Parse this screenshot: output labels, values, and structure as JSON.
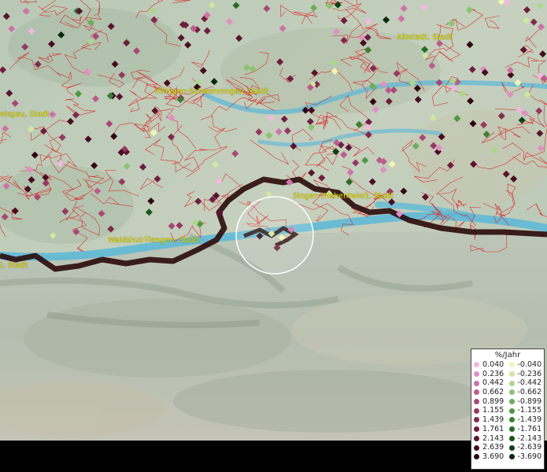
{
  "map": {
    "labels": [
      {
        "id": "albstadt",
        "text": "Albstadt, Stadt"
      },
      {
        "id": "villingen",
        "text": "Villingen-Schwenningen, Stadt"
      },
      {
        "id": "breisgau",
        "text": "eisgau, Stadt"
      },
      {
        "id": "singen",
        "text": "Singen (Hohentwiel), Stadt"
      },
      {
        "id": "waldshut",
        "text": "Waldshut-Tiengen, Stadt"
      },
      {
        "id": "west",
        "text": "), Stadt"
      }
    ]
  },
  "legend": {
    "title": "%/Jahr",
    "positive": [
      {
        "label": "0.040",
        "color": "#f2b8e0"
      },
      {
        "label": "0.236",
        "color": "#e090c4"
      },
      {
        "label": "0.442",
        "color": "#cf72a8"
      },
      {
        "label": "0.662",
        "color": "#bc5c8e"
      },
      {
        "label": "0.899",
        "color": "#a84876"
      },
      {
        "label": "1.155",
        "color": "#963862"
      },
      {
        "label": "1.439",
        "color": "#822a50"
      },
      {
        "label": "1.761",
        "color": "#6e1e40"
      },
      {
        "label": "2.143",
        "color": "#5a1430"
      },
      {
        "label": "2.639",
        "color": "#460c22"
      },
      {
        "label": "3.690",
        "color": "#300614"
      }
    ],
    "negative": [
      {
        "label": "-0.040",
        "color": "#f0f8b0"
      },
      {
        "label": "-0.236",
        "color": "#cfe8a0"
      },
      {
        "label": "-0.442",
        "color": "#acd88a"
      },
      {
        "label": "-0.662",
        "color": "#8cc470"
      },
      {
        "label": "-0.899",
        "color": "#6aae56"
      },
      {
        "label": "-1.155",
        "color": "#4e9840"
      },
      {
        "label": "-1.439",
        "color": "#388230"
      },
      {
        "label": "-1.761",
        "color": "#266c22"
      },
      {
        "label": "-2.143",
        "color": "#185618"
      },
      {
        "label": "-2.639",
        "color": "#0e4010"
      },
      {
        "label": "-3.690",
        "color": "#062a08"
      }
    ]
  }
}
